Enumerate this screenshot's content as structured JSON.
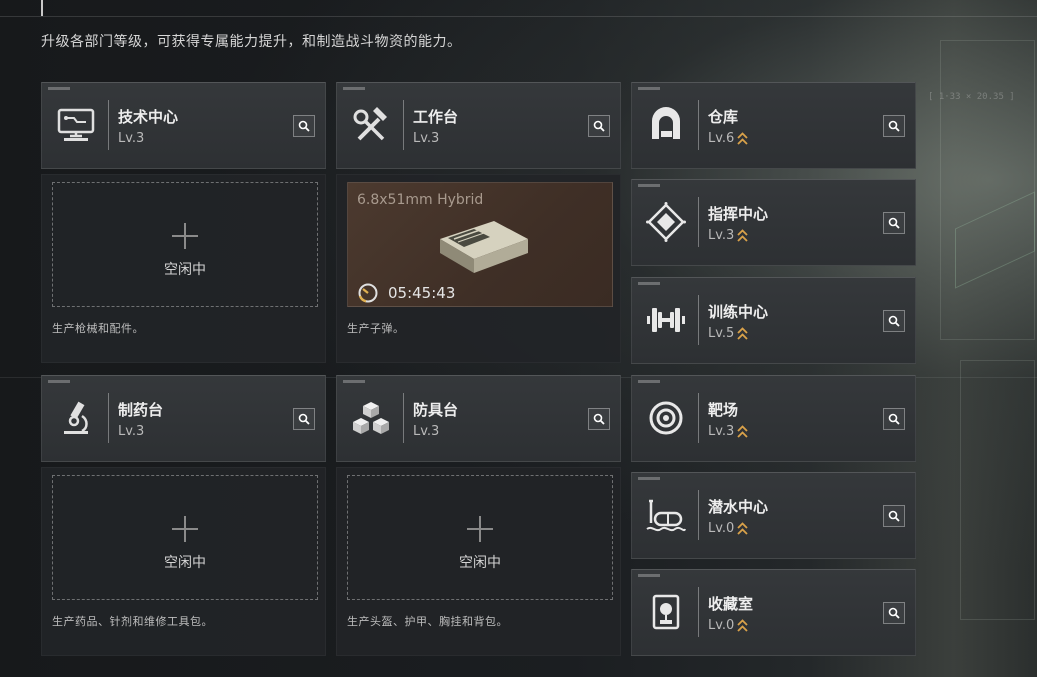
{
  "header": {
    "subtitle": "升级各部门等级，可获得专属能力提升，和制造战斗物资的能力。",
    "coord": "[ 1·33 × 20.35 ]"
  },
  "colors": {
    "accent_upgrade": "#d9a24a",
    "card_bg": "#33363a",
    "panel_bg": "#232528"
  },
  "facilities": [
    {
      "name": "技术中心",
      "level": "Lv.3",
      "icon": "monitor-icon",
      "upgradable": false
    },
    {
      "name": "工作台",
      "level": "Lv.3",
      "icon": "hammer-wrench-icon",
      "upgradable": false
    },
    {
      "name": "仓库",
      "level": "Lv.6",
      "icon": "warehouse-icon",
      "upgradable": true
    },
    {
      "name": "指挥中心",
      "level": "Lv.3",
      "icon": "command-diamond-icon",
      "upgradable": true
    },
    {
      "name": "训练中心",
      "level": "Lv.5",
      "icon": "dumbbell-icon",
      "upgradable": true
    },
    {
      "name": "制药台",
      "level": "Lv.3",
      "icon": "microscope-icon",
      "upgradable": false
    },
    {
      "name": "防具台",
      "level": "Lv.3",
      "icon": "cubes-icon",
      "upgradable": false
    },
    {
      "name": "靶场",
      "level": "Lv.3",
      "icon": "target-icon",
      "upgradable": true
    },
    {
      "name": "潜水中心",
      "level": "Lv.0",
      "icon": "diving-mask-icon",
      "upgradable": true
    },
    {
      "name": "收藏室",
      "level": "Lv.0",
      "icon": "display-case-icon",
      "upgradable": true
    }
  ],
  "production": {
    "idle_label": "空闲中",
    "tech_desc": "生产枪械和配件。",
    "workbench_desc": "生产子弹。",
    "pharma_desc": "生产药品、针剂和维修工具包。",
    "armor_desc": "生产头盔、护甲、胸挂和背包。",
    "workbench_item": "6.8x51mm Hybrid",
    "workbench_timer": "05:45:43"
  }
}
